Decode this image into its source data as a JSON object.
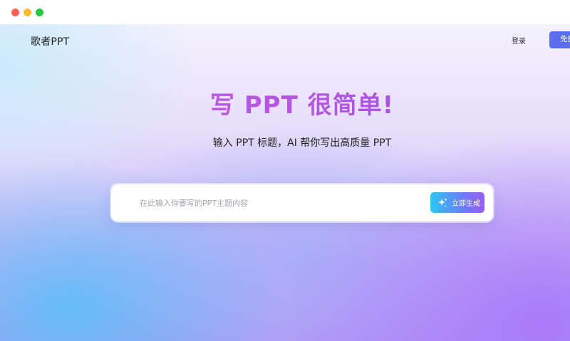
{
  "window": {
    "controls": [
      "close",
      "minimize",
      "zoom"
    ],
    "control_colors": {
      "close": "#fe5f57",
      "minimize": "#febc2e",
      "zoom": "#28c840"
    }
  },
  "header": {
    "brand_name": "歌者PPT",
    "brand_icon": "sound-wave-icon",
    "login_label": "登录",
    "free_label": "免费使用",
    "accent_color": "#5b6ef2"
  },
  "hero": {
    "title": "写 PPT 很简单!",
    "subtitle": "输入 PPT 标题，AI 帮你写出高质量 PPT",
    "title_color": "#b556e2"
  },
  "search": {
    "icon": "sound-wave-icon",
    "placeholder": "在此输入你要写的PPT主题内容",
    "value": "",
    "button_label": "立即生成",
    "button_icon": "sparkle-icon"
  }
}
